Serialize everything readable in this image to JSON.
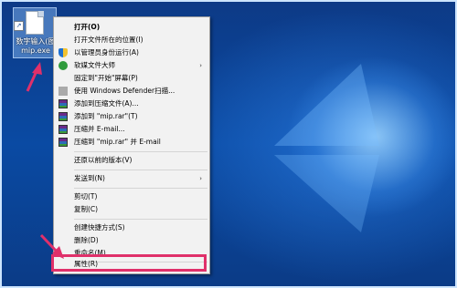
{
  "desktop": {
    "icon_label": "数字输入(图",
    "icon_label_2": "mip.exe"
  },
  "menu": {
    "items": [
      {
        "label": "打开(O)",
        "bold": true,
        "icon": ""
      },
      {
        "label": "打开文件所在的位置(I)",
        "icon": ""
      },
      {
        "label": "以管理员身份运行(A)",
        "icon": "shield-icon"
      },
      {
        "label": "软媒文件大师",
        "icon": "ruanmei-icon",
        "submenu": true
      },
      {
        "label": "固定到\"开始\"屏幕(P)",
        "icon": ""
      },
      {
        "label": "使用 Windows Defender扫描...",
        "icon": "defender-icon"
      },
      {
        "label": "添加到压缩文件(A)...",
        "icon": "winrar-icon"
      },
      {
        "label": "添加到 \"mip.rar\"(T)",
        "icon": "winrar-icon"
      },
      {
        "label": "压缩并 E-mail...",
        "icon": "winrar-icon"
      },
      {
        "label": "压缩到 \"mip.rar\" 并 E-mail",
        "icon": "winrar-icon"
      },
      {
        "label": "还原以前的版本(V)",
        "icon": ""
      },
      {
        "label": "发送到(N)",
        "icon": "",
        "submenu": true
      },
      {
        "label": "剪切(T)",
        "icon": ""
      },
      {
        "label": "复制(C)",
        "icon": ""
      },
      {
        "label": "创建快捷方式(S)",
        "icon": ""
      },
      {
        "label": "删除(D)",
        "icon": ""
      },
      {
        "label": "重命名(M)",
        "icon": ""
      },
      {
        "label": "属性(R)",
        "icon": ""
      }
    ],
    "submenu_glyph": "›"
  },
  "colors": {
    "highlight": "#e0306a",
    "desktop": "#0b3d8f"
  }
}
